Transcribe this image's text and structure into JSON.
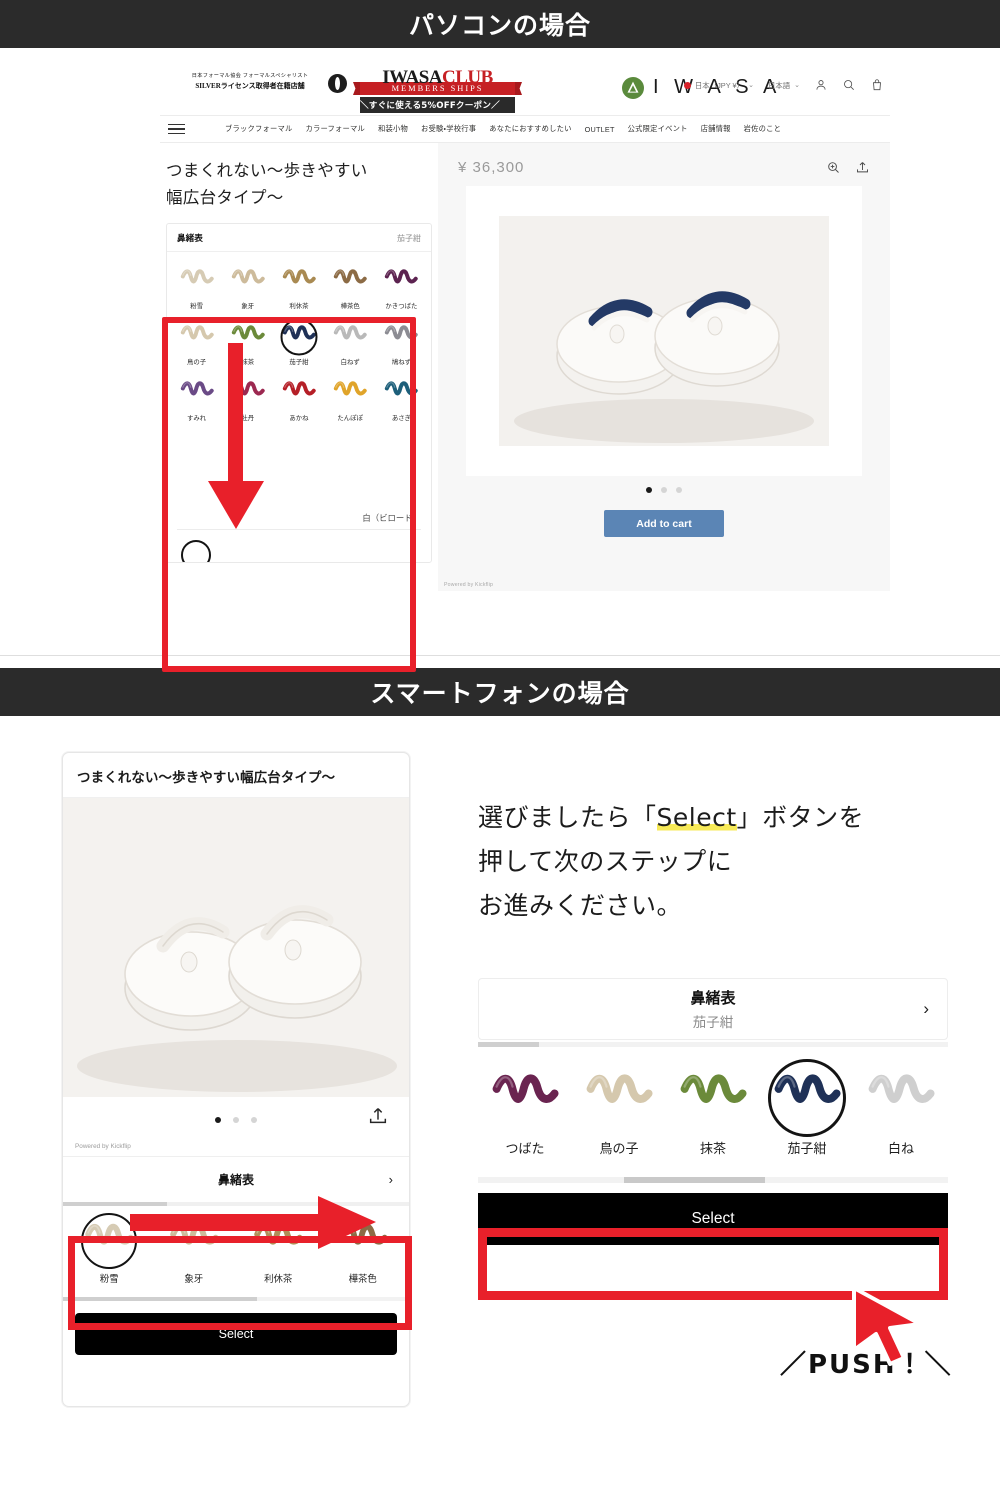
{
  "banners": {
    "pc": "パソコンの場合",
    "sp": "スマートフォンの場合"
  },
  "pc": {
    "header": {
      "silver_badge_line1": "日本フォーマル協会 フォーマルスペシャリスト",
      "silver_badge_line2": "SILVERライセンス取得者在籍店舗",
      "club_logo_iwasa": "IWASA",
      "club_logo_club": "CLUB",
      "club_members": "MEMBERS SHIPS",
      "club_coupon": "＼すぐに使える5%OFFクーポン／",
      "brand_wordmark": "I W A S A",
      "currency": "日本（JPY ¥）",
      "language": "日本語",
      "icons": [
        "account-icon",
        "search-icon",
        "bag-icon"
      ]
    },
    "nav": [
      "ブラックフォーマル",
      "カラーフォーマル",
      "和装小物",
      "お受験・学校行事",
      "あなたにおすすめしたい",
      "OUTLET",
      "公式限定イベント",
      "店舗情報",
      "岩佐のこと"
    ],
    "product_title": "つまくれない〜歩きやすい\n幅広台タイプ〜",
    "product_title_line1": "つまくれない〜歩きやすい",
    "product_title_line2": "幅広台タイプ〜",
    "price": "¥ 36,300",
    "picker": {
      "label": "鼻緒表",
      "value": "茄子紺",
      "next_section_value": "白（ビロード）",
      "swatches": [
        {
          "label": "粉雪",
          "color": "#d6cbb4",
          "selected": false
        },
        {
          "label": "象牙",
          "color": "#cdbb9b",
          "selected": false
        },
        {
          "label": "利休茶",
          "color": "#a98a52",
          "selected": false
        },
        {
          "label": "樺茶色",
          "color": "#8c6b45",
          "selected": false
        },
        {
          "label": "かきつばた",
          "color": "#5c2350",
          "selected": false
        },
        {
          "label": "鳥の子",
          "color": "#d5c8ad",
          "selected": false
        },
        {
          "label": "抹茶",
          "color": "#6b8a3a",
          "selected": false
        },
        {
          "label": "茄子紺",
          "color": "#1f3157",
          "selected": true
        },
        {
          "label": "白ねず",
          "color": "#b9b9b9",
          "selected": false
        },
        {
          "label": "鳩ねず",
          "color": "#8c8c93",
          "selected": false
        },
        {
          "label": "すみれ",
          "color": "#6a4a86",
          "selected": false
        },
        {
          "label": "牡丹",
          "color": "#9c2850",
          "selected": false
        },
        {
          "label": "あかね",
          "color": "#b51f27",
          "selected": false
        },
        {
          "label": "たんぽぽ",
          "color": "#e0a42a",
          "selected": false
        },
        {
          "label": "あさぎ",
          "color": "#1d5f7a",
          "selected": false
        }
      ]
    },
    "gallery": {
      "zoom_icon": "zoom-in-icon",
      "share_icon": "share-icon",
      "prev_icon": "chevron-left-icon",
      "next_icon": "chevron-right-icon",
      "dots": 3,
      "active_dot": 0
    },
    "cart_button": "Add to cart",
    "powered_by": "Powered by Kickflip",
    "accent_cart_color": "#5b85b5",
    "callout_color": "#e8202a"
  },
  "sp": {
    "phone": {
      "title": "つまくれない〜歩きやすい幅広台タイプ〜",
      "powered_by": "Powered by Kickflip",
      "row_label": "鼻緒表",
      "chevron": "›",
      "dots": 3,
      "active_dot": 0,
      "share_icon": "share-icon",
      "swatches": [
        {
          "label": "粉雪",
          "color": "#d6cbb4",
          "selected": true
        },
        {
          "label": "象牙",
          "color": "#cdbb9b",
          "selected": false
        },
        {
          "label": "利休茶",
          "color": "#b08f58",
          "selected": false
        },
        {
          "label": "樺茶色",
          "color": "#8c6b45",
          "selected": false
        }
      ],
      "select_button": "Select"
    },
    "instruction": {
      "line1_a": "選びましたら「",
      "line1_hl": "Select",
      "line1_b": "」ボタンを",
      "line2": "押して次のステップに",
      "line3": "お進みください。",
      "highlight_color": "#f7ea57"
    },
    "panel": {
      "row_label": "鼻緒表",
      "row_value": "茄子紺",
      "chevron": "›",
      "swatches": [
        {
          "label": "つばた",
          "color": "#6a2450",
          "selected": false
        },
        {
          "label": "鳥の子",
          "color": "#d5c8ad",
          "selected": false
        },
        {
          "label": "抹茶",
          "color": "#6b8a3a",
          "selected": false
        },
        {
          "label": "茄子紺",
          "color": "#1f3157",
          "selected": true
        },
        {
          "label": "白ね",
          "color": "#cfcfcf",
          "selected": false
        }
      ],
      "select_button": "Select"
    },
    "push_text": "／PUSH！＼",
    "callout_color": "#e8202a"
  }
}
